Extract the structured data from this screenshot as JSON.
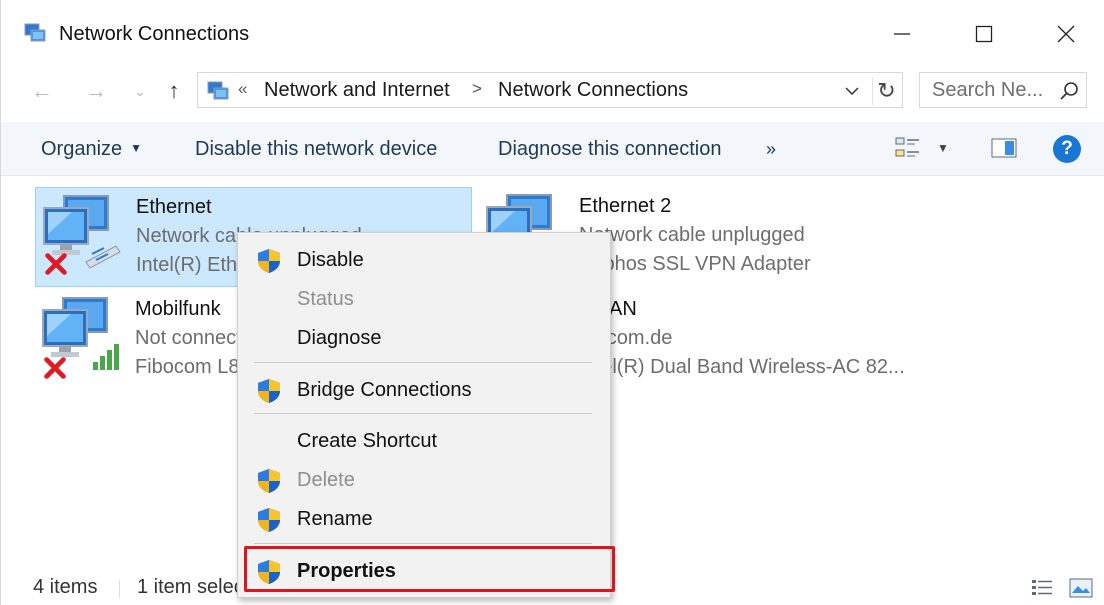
{
  "window": {
    "title": "Network Connections",
    "minimize": "—",
    "maximize": "☐",
    "close": "✕"
  },
  "nav": {
    "back": "←",
    "forward": "→",
    "recent": "⌄",
    "up": "↑",
    "breadcrumb_prefix": "«",
    "breadcrumbs": [
      "Network and Internet",
      "Network Connections"
    ],
    "separator": ">",
    "refresh": "↻",
    "search_placeholder": "Search Ne..."
  },
  "toolbar": {
    "organize": "Organize",
    "organize_caret": "▼",
    "disable": "Disable this network device",
    "diagnose": "Diagnose this connection",
    "more": "»",
    "view_caret": "▼",
    "help": "?"
  },
  "items": [
    {
      "name": "Ethernet",
      "status": "Network cable unplugged",
      "adapter": "Intel(R) Ethernet Connection",
      "selected": true
    },
    {
      "name": "Ethernet 2",
      "status": "Network cable unplugged",
      "adapter": "Sophos SSL VPN Adapter",
      "selected": false
    },
    {
      "name": "Mobilfunk",
      "status": "Not connected",
      "adapter": "Fibocom L8",
      "selected": false
    },
    {
      "name": "WLAN",
      "status": "sarcom.de",
      "adapter": "Intel(R) Dual Band Wireless-AC 82...",
      "selected": false
    }
  ],
  "statusbar": {
    "count": "4 items",
    "selected": "1 item selected"
  },
  "context_menu": {
    "items": [
      {
        "label": "Disable",
        "shield": true,
        "enabled": true
      },
      {
        "label": "Status",
        "shield": false,
        "enabled": false
      },
      {
        "label": "Diagnose",
        "shield": false,
        "enabled": true
      },
      {
        "label": "Bridge Connections",
        "shield": true,
        "enabled": true
      },
      {
        "label": "Create Shortcut",
        "shield": false,
        "enabled": true
      },
      {
        "label": "Delete",
        "shield": true,
        "enabled": false
      },
      {
        "label": "Rename",
        "shield": true,
        "enabled": true
      },
      {
        "label": "Properties",
        "shield": true,
        "enabled": true,
        "default": true
      }
    ]
  },
  "colors": {
    "selection_bg": "#cce8ff",
    "command_text": "#1e3957",
    "highlight": "#e0141b",
    "help_blue": "#1977d4"
  },
  "icons": {
    "network_adapter": "network-adapter-icon",
    "disconnected": "red-x-icon",
    "uac": "uac-shield-icon"
  }
}
